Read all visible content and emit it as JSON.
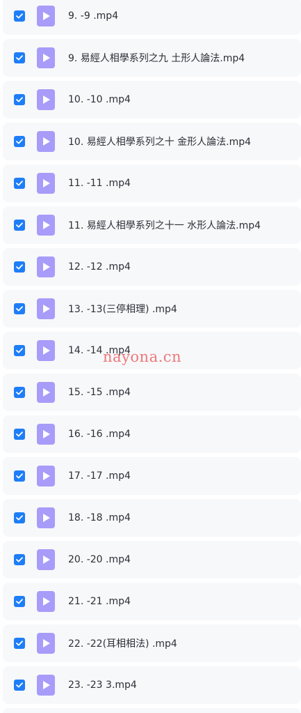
{
  "files": [
    {
      "name": "9. -9 .mp4",
      "checked": true,
      "icon": "video-file-icon"
    },
    {
      "name": "9. 易經人相學系列之九 土形人論法.mp4",
      "checked": true,
      "icon": "video-file-icon"
    },
    {
      "name": "10. -10 .mp4",
      "checked": true,
      "icon": "video-file-icon"
    },
    {
      "name": "10. 易經人相學系列之十 金形人論法.mp4",
      "checked": true,
      "icon": "video-file-icon"
    },
    {
      "name": "11. -11 .mp4",
      "checked": true,
      "icon": "video-file-icon"
    },
    {
      "name": "11. 易經人相學系列之十一 水形人論法.mp4",
      "checked": true,
      "icon": "video-file-icon"
    },
    {
      "name": "12. -12 .mp4",
      "checked": true,
      "icon": "video-file-icon"
    },
    {
      "name": "13. -13(三停相理) .mp4",
      "checked": true,
      "icon": "video-file-icon"
    },
    {
      "name": "14. -14 .mp4",
      "checked": true,
      "icon": "video-file-icon"
    },
    {
      "name": "15. -15 .mp4",
      "checked": true,
      "icon": "video-file-icon"
    },
    {
      "name": "16. -16 .mp4",
      "checked": true,
      "icon": "video-file-icon"
    },
    {
      "name": "17. -17 .mp4",
      "checked": true,
      "icon": "video-file-icon"
    },
    {
      "name": "18. -18 .mp4",
      "checked": true,
      "icon": "video-file-icon"
    },
    {
      "name": "20. -20 .mp4",
      "checked": true,
      "icon": "video-file-icon"
    },
    {
      "name": "21. -21 .mp4",
      "checked": true,
      "icon": "video-file-icon"
    },
    {
      "name": "22. -22(耳相相法) .mp4",
      "checked": true,
      "icon": "video-file-icon"
    },
    {
      "name": "23. -23 3.mp4",
      "checked": true,
      "icon": "video-file-icon"
    },
    {
      "name": "",
      "checked": false,
      "icon": ""
    }
  ],
  "watermark": "nayona.cn",
  "colors": {
    "checkbox": "#1e7ef7",
    "file_icon": "#a79cf9",
    "row_background": "#f7f8fa",
    "text": "#2b2f36",
    "watermark": "#eb5a5a"
  }
}
